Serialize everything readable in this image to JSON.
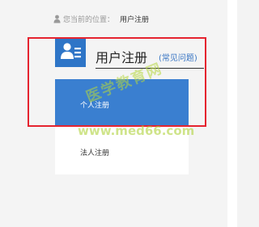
{
  "breadcrumb": {
    "label": "您当前的位置：",
    "current": "用户注册"
  },
  "header": {
    "title": "用户注册",
    "faq_link": "(常见问题)"
  },
  "menu": {
    "items": [
      {
        "label": "个人注册",
        "active": true
      },
      {
        "label": "法人注册",
        "active": false
      }
    ]
  },
  "watermark": {
    "line1": "医学教育网",
    "line2": "www.med66.com"
  },
  "colors": {
    "accent_blue": "#3a7fd0",
    "icon_blue": "#2e75c7",
    "highlight_red": "#e5232f",
    "link_blue": "#3a76c4"
  },
  "icons": {
    "breadcrumb": "user-icon",
    "header": "user-card-icon"
  }
}
